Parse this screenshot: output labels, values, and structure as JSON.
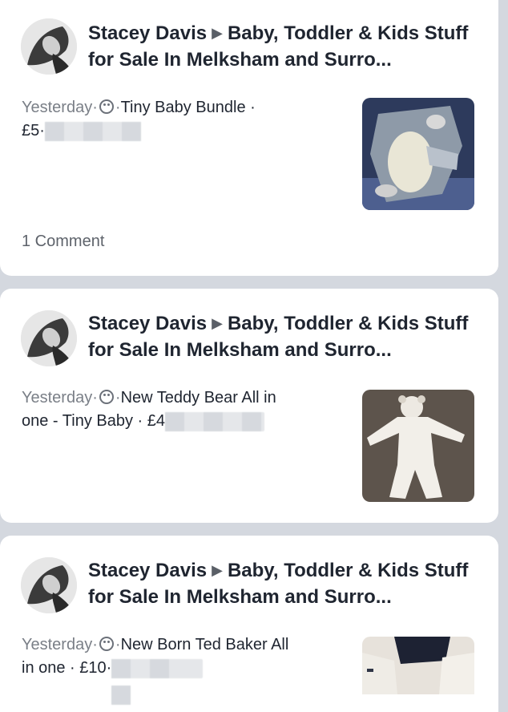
{
  "posts": [
    {
      "author": "Stacey Davis",
      "group": "Baby, Toddler & Kids Stuff for Sale In Melksham and Surro...",
      "time": "Yesterday",
      "text_line1": "Tiny Baby Bundle ·",
      "text_line2": "£5·",
      "comments": "1 Comment",
      "thumb_icon": "baby-bundle-photo"
    },
    {
      "author": "Stacey Davis",
      "group": "Baby, Toddler & Kids Stuff for Sale In Melksham and Surro...",
      "time": "Yesterday",
      "text_line1": "New Teddy Bear All in",
      "text_line2": "one - Tiny Baby · £4",
      "thumb_icon": "teddy-onesie-photo"
    },
    {
      "author": "Stacey Davis",
      "group": "Baby, Toddler & Kids Stuff for Sale In Melksham and Surro...",
      "time": "Yesterday",
      "text_line1": "New Born Ted Baker All",
      "text_line2": "in one · £10·",
      "thumb_icon": "ted-baker-onesie-photo"
    }
  ],
  "arrow_glyph": "▶",
  "sep": "·"
}
